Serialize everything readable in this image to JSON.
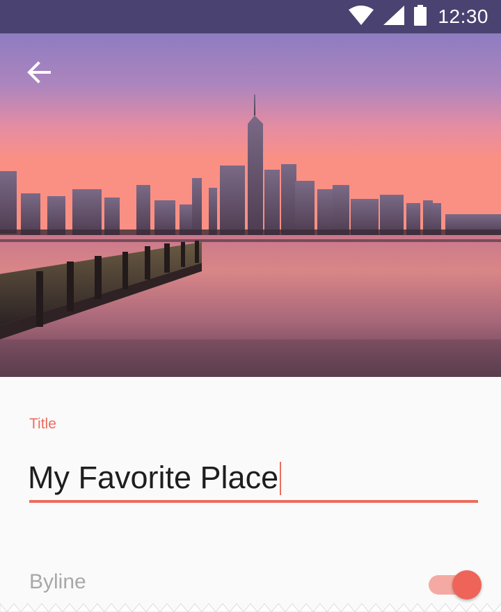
{
  "status_bar": {
    "time": "12:30",
    "icons": [
      "wifi-icon",
      "signal-icon",
      "battery-icon"
    ],
    "color": "#4a4270"
  },
  "hero": {
    "image_subject": "city skyline at sunset reflected in water with a wooden pier",
    "back_icon": "arrow-back-icon"
  },
  "form": {
    "title_label": "Title",
    "title_value": "My Favorite Place",
    "byline_label": "Byline",
    "byline_toggle_on": true
  },
  "colors": {
    "accent": "#ee6b5e",
    "status_bar": "#4a4270",
    "label_grey": "#a8a8a8",
    "text": "#1e1e1e"
  }
}
